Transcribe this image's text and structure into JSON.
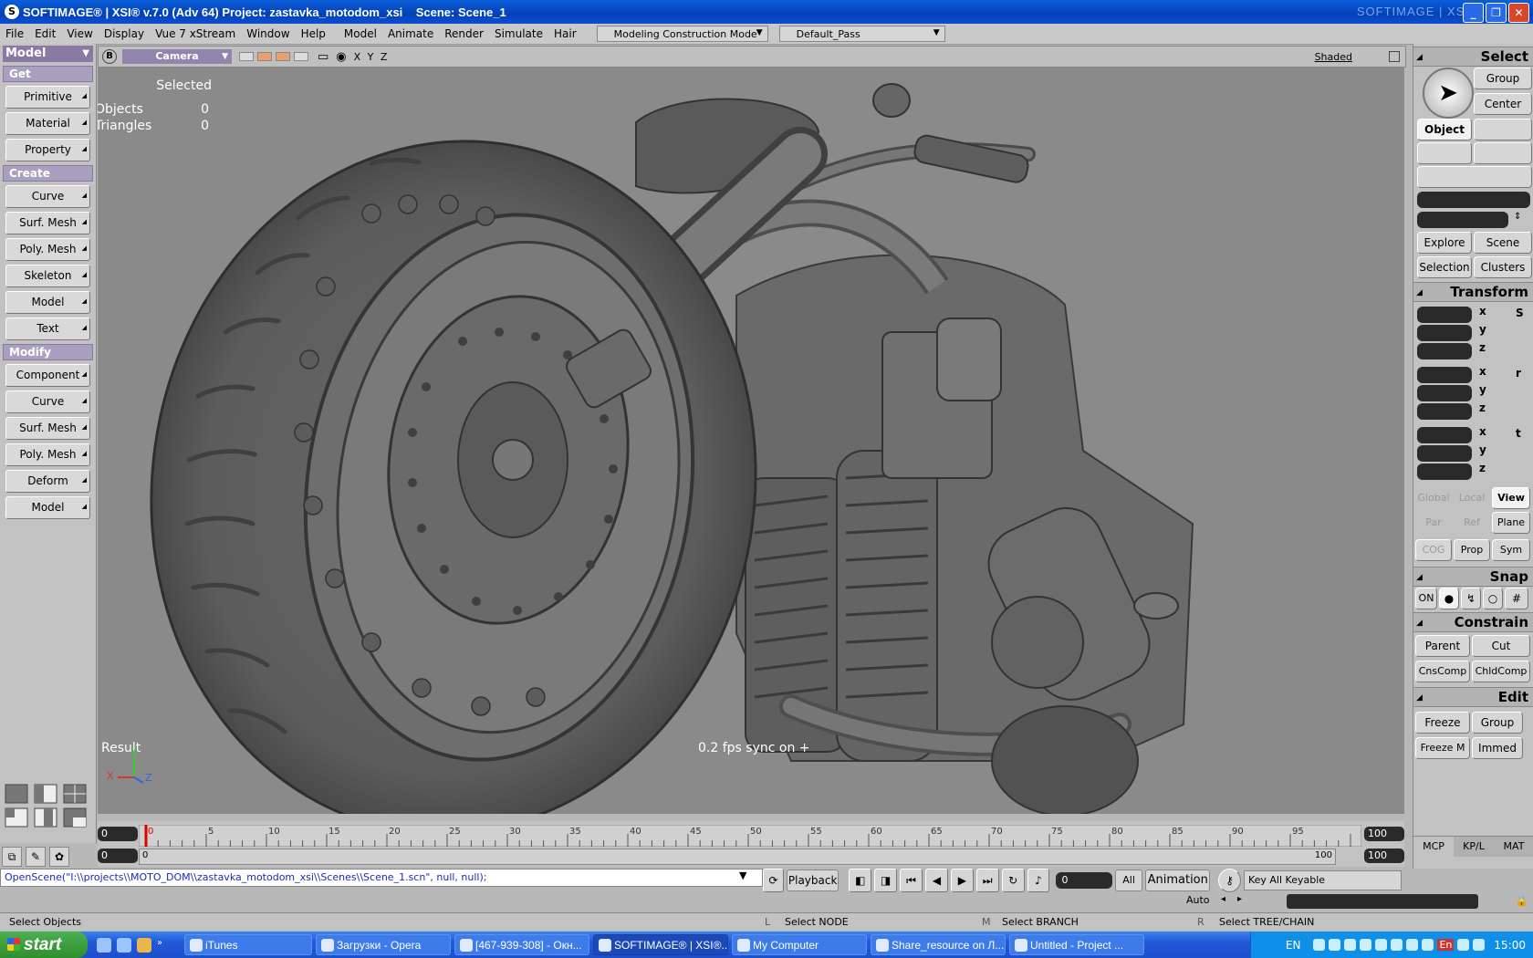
{
  "window": {
    "title": "SOFTIMAGE® | XSI® v.7.0 (Adv 64) Project: zastavka_motodom_xsi    Scene: Scene_1",
    "brand": "SOFTIMAGE | XSI"
  },
  "menubar": {
    "items": [
      "File",
      "Edit",
      "View",
      "Display",
      "Vue 7 xStream",
      "Window",
      "Help",
      "Model",
      "Animate",
      "Render",
      "Simulate",
      "Hair"
    ],
    "mode": "Modeling Construction Mode",
    "pass": "Default_Pass"
  },
  "left_panel": {
    "module": "Model",
    "sections": [
      {
        "title": "Get",
        "buttons": [
          "Primitive",
          "Material",
          "Property"
        ]
      },
      {
        "title": "Create",
        "buttons": [
          "Curve",
          "Surf. Mesh",
          "Poly. Mesh",
          "Skeleton",
          "Model",
          "Text"
        ]
      },
      {
        "title": "Modify",
        "buttons": [
          "Component",
          "Curve",
          "Surf. Mesh",
          "Poly. Mesh",
          "Deform",
          "Model"
        ]
      }
    ]
  },
  "viewport": {
    "badge": "B",
    "camera": "Camera",
    "xyz": "X Y Z",
    "shading": "Shaded",
    "stats_title": "Selected",
    "stats": [
      {
        "label": "Objects",
        "value": "0"
      },
      {
        "label": "Triangles",
        "value": "0"
      }
    ],
    "result_label": "Result",
    "fps_text": "0.2 fps sync on +",
    "axes": {
      "x": "X",
      "y": "Y",
      "z": "Z"
    }
  },
  "timeline": {
    "start_field": "0",
    "start_field2": "0",
    "ticks": [
      "0",
      "5",
      "10",
      "15",
      "20",
      "25",
      "30",
      "35",
      "40",
      "45",
      "50",
      "55",
      "60",
      "65",
      "70",
      "75",
      "80",
      "85",
      "90",
      "95"
    ],
    "range_start": "0",
    "range_end": "100",
    "end_field": "100",
    "end_field2": "100",
    "current_frame": 0
  },
  "command_line": "OpenScene(\"I:\\\\projects\\\\MOTO_DOM\\\\zastavka_motodom_xsi\\\\Scenes\\\\Scene_1.scn\", null, null);",
  "playback": {
    "label": "Playback",
    "frame": "0",
    "all": "All",
    "animation": "Animation",
    "auto": "Auto",
    "key": "Key All Keyable"
  },
  "status": {
    "left": "Select Objects",
    "l_key": "L",
    "l_text": "Select NODE",
    "m_key": "M",
    "m_text": "Select BRANCH",
    "r_key": "R",
    "r_text": "Select TREE/CHAIN"
  },
  "right_panel": {
    "select_title": "Select",
    "group": "Group",
    "center": "Center",
    "object": "Object",
    "explore": "Explore",
    "scene": "Scene",
    "selection": "Selection",
    "clusters": "Clusters",
    "transform_title": "Transform",
    "axes": [
      "x",
      "y",
      "z"
    ],
    "s": "S",
    "r": "r",
    "t": "t",
    "global": "Global",
    "local": "Local",
    "view": "View",
    "par": "Par",
    "ref": "Ref",
    "plane": "Plane",
    "cog": "COG",
    "prop": "Prop",
    "sym": "Sym",
    "snap_title": "Snap",
    "on": "ON",
    "constrain_title": "Constrain",
    "parent": "Parent",
    "cut": "Cut",
    "cnscomp": "CnsComp",
    "chldcomp": "ChldComp",
    "edit_title": "Edit",
    "freeze": "Freeze",
    "edit_group": "Group",
    "freezem": "Freeze M",
    "immed": "Immed",
    "tabs": [
      "MCP",
      "KP/L",
      "MAT"
    ]
  },
  "taskbar": {
    "start": "start",
    "tasks": [
      {
        "label": "iTunes",
        "w": 140
      },
      {
        "label": "Загрузки - Opera",
        "w": 148
      },
      {
        "label": "[467-939-308] - Окн...",
        "w": 148
      },
      {
        "label": "SOFTIMAGE® | XSI®...",
        "w": 148,
        "active": true
      },
      {
        "label": "My Computer",
        "w": 148
      },
      {
        "label": "Share_resource on Л...",
        "w": 148
      },
      {
        "label": "Untitled      - Project ...",
        "w": 148
      }
    ],
    "lang": "EN",
    "lang2": "En",
    "time": "15:00"
  }
}
